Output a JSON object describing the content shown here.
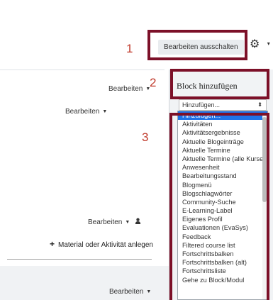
{
  "header": {
    "edit_button_label": "Bearbeiten ausschalten",
    "gear_caret": "▾"
  },
  "annotations": {
    "one": "1",
    "two": "2",
    "three": "3"
  },
  "left": {
    "edit_links": [
      "Bearbeiten",
      "Bearbeiten",
      "Bearbeiten",
      "Bearbeiten"
    ],
    "add_material_label": "Material oder Aktivität anlegen"
  },
  "block": {
    "title": "Block hinzufügen",
    "select_value": "Hinzufügen...",
    "options": [
      "Hinzufügen...",
      "Aktivitäten",
      "Aktivitätsergebnisse",
      "Aktuelle Blogeinträge",
      "Aktuelle Termine",
      "Aktuelle Termine (alle Kurse)",
      "Anwesenheit",
      "Bearbeitungsstand",
      "Blogmenü",
      "Blogschlagwörter",
      "Community-Suche",
      "E-Learning-Label",
      "Eigenes Profil",
      "Evaluationen (EvaSys)",
      "Feedback",
      "Filtered course list",
      "Fortschrittsbalken",
      "Fortschrittsbalken (alt)",
      "Fortschrittsliste",
      "Gehe zu Block/Modul"
    ],
    "selected_index": 0
  },
  "colors": {
    "highlight": "#7c1028",
    "annotation": "#c0392b",
    "selected_option": "#1e73e8"
  }
}
